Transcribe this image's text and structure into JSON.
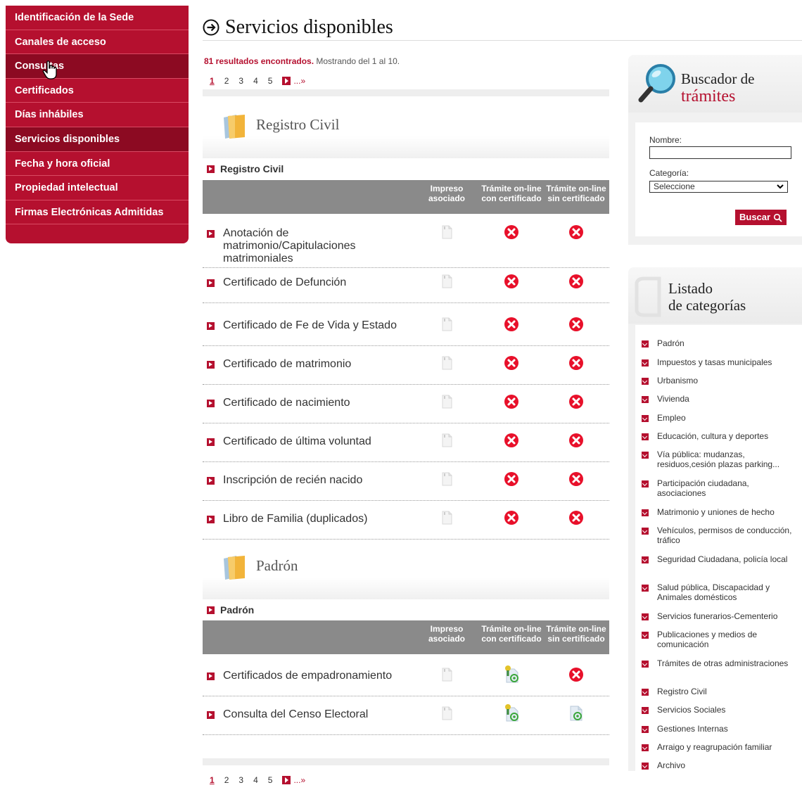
{
  "nav": {
    "items": [
      {
        "label": "Identificación de la Sede",
        "active": false
      },
      {
        "label": "Canales de acceso",
        "active": false
      },
      {
        "label": "Consultas",
        "active": true
      },
      {
        "label": "Certificados",
        "active": false
      },
      {
        "label": "Días inhábiles",
        "active": false
      },
      {
        "label": "Servicios disponibles",
        "active": true
      },
      {
        "label": "Fecha y hora oficial",
        "active": false
      },
      {
        "label": "Propiedad intelectual",
        "active": false
      },
      {
        "label": "Firmas Electrónicas Admitidas",
        "active": false
      }
    ]
  },
  "page": {
    "title": "Servicios disponibles",
    "results_count": "81 resultados encontrados.",
    "results_range": " Mostrando del 1 al 10."
  },
  "pager": {
    "pages": [
      "1",
      "2",
      "3",
      "4",
      "5"
    ],
    "more": "...»"
  },
  "table_headers": {
    "col1": "Impreso asociado",
    "col2": "Trámite on-line con certificado",
    "col3": "Trámite on-line sin certificado"
  },
  "sections": [
    {
      "title": "Registro Civil",
      "subtitle": "Registro Civil",
      "rows": [
        {
          "name": "Anotación de matrimonio/Capitulaciones matrimoniales",
          "con": "no",
          "sin": "no"
        },
        {
          "name": "Certificado de Defunción",
          "con": "no",
          "sin": "no"
        },
        {
          "name": "Certificado de Fe de Vida y Estado",
          "con": "no",
          "sin": "no"
        },
        {
          "name": "Certificado de matrimonio",
          "con": "no",
          "sin": "no"
        },
        {
          "name": "Certificado de nacimiento",
          "con": "no",
          "sin": "no"
        },
        {
          "name": "Certificado de última voluntad",
          "con": "no",
          "sin": "no"
        },
        {
          "name": "Inscripción de recién nacido",
          "con": "no",
          "sin": "no"
        },
        {
          "name": "Libro de Familia (duplicados)",
          "con": "no",
          "sin": "no"
        }
      ]
    },
    {
      "title": "Padrón",
      "subtitle": "Padrón",
      "rows": [
        {
          "name": "Certificados de empadronamiento",
          "con": "cert-online",
          "sin": "no"
        },
        {
          "name": "Consulta del Censo Electoral",
          "con": "cert-online",
          "sin": "online"
        }
      ]
    }
  ],
  "buscador": {
    "title_1": "Buscador de",
    "title_2": "trámites",
    "nombre_label": "Nombre:",
    "nombre_value": "",
    "categoria_label": "Categoría:",
    "categoria_selected": "Seleccione",
    "button": "Buscar"
  },
  "listado": {
    "title_1": "Listado",
    "title_2": "de categorías",
    "categories": [
      "Padrón",
      "Impuestos y tasas municipales",
      "Urbanismo",
      "Vivienda",
      "Empleo",
      "Educación, cultura y deportes",
      "Vía pública: mudanzas, residuos,cesión plazas parking...",
      "Participación ciudadana, asociaciones",
      "Matrimonio y uniones de hecho",
      "Vehículos, permisos de conducción, tráfico",
      "Seguridad Ciudadana, policía local",
      "Salud pública, Discapacidad y Animales domésticos",
      "Servicios funerarios-Cementerio",
      "Publicaciones y medios de comunicación",
      "Trámites de otras administraciones",
      "Registro Civil",
      "Servicios Sociales",
      "Gestiones Internas",
      "Arraigo y reagrupación familiar",
      "Archivo"
    ]
  },
  "colors": {
    "brand": "#b5102f",
    "brand_dark": "#8c0a22",
    "header_gray": "#8a8a8a"
  }
}
